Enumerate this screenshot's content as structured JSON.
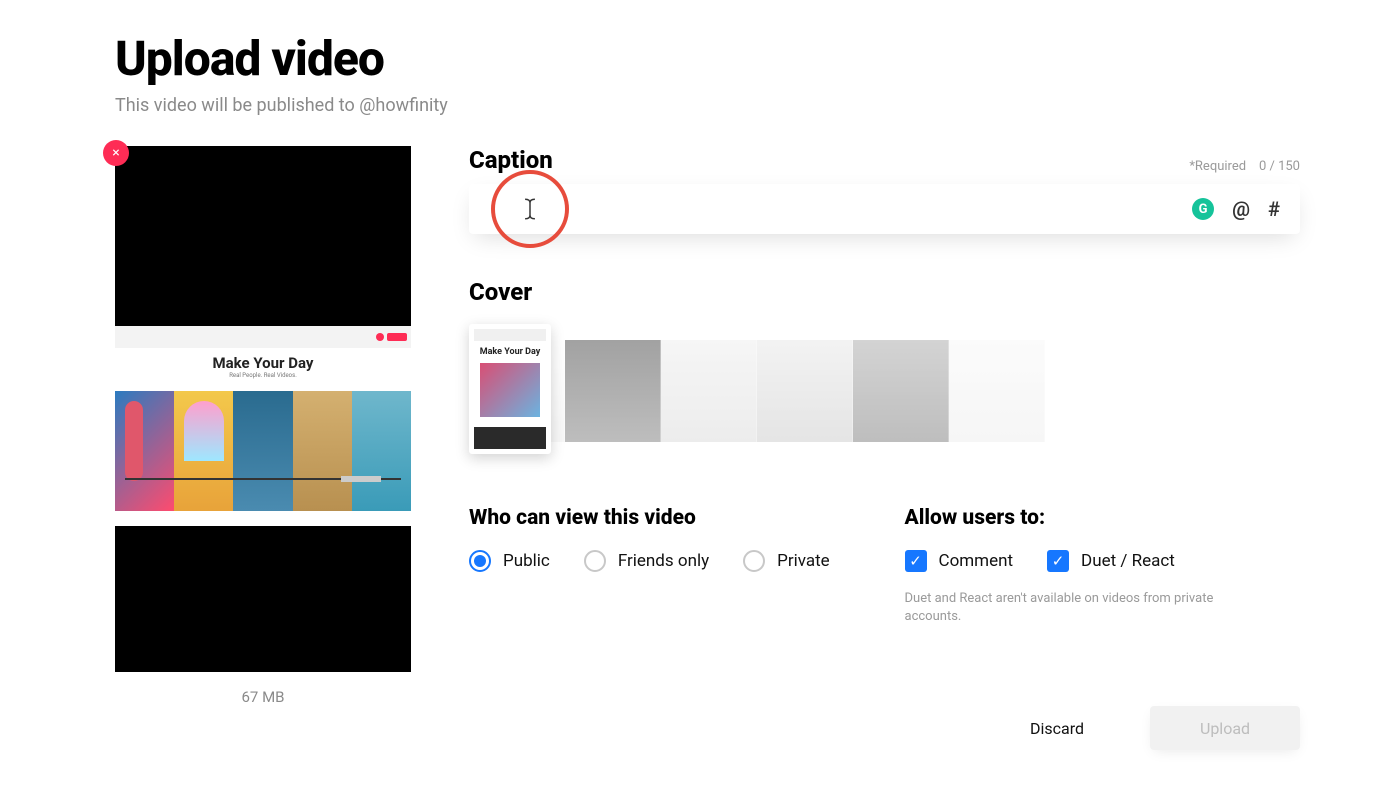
{
  "header": {
    "title": "Upload video",
    "subtitle": "This video will be published to @howfinity"
  },
  "preview": {
    "close_label": "×",
    "embedded_title": "Make Your Day",
    "file_size": "67 MB"
  },
  "caption": {
    "label": "Caption",
    "required_text": "*Required",
    "counter": "0 / 150",
    "grammarly_badge": "G",
    "mention_symbol": "@",
    "hashtag_symbol": "#"
  },
  "cover": {
    "label": "Cover",
    "selected_title": "Make Your Day"
  },
  "privacy": {
    "label": "Who can view this video",
    "options": [
      {
        "label": "Public",
        "selected": true
      },
      {
        "label": "Friends only",
        "selected": false
      },
      {
        "label": "Private",
        "selected": false
      }
    ]
  },
  "permissions": {
    "label": "Allow users to:",
    "options": [
      {
        "label": "Comment",
        "checked": true
      },
      {
        "label": "Duet / React",
        "checked": true
      }
    ],
    "note": "Duet and React aren't available on videos from private accounts."
  },
  "footer": {
    "discard": "Discard",
    "upload": "Upload"
  }
}
